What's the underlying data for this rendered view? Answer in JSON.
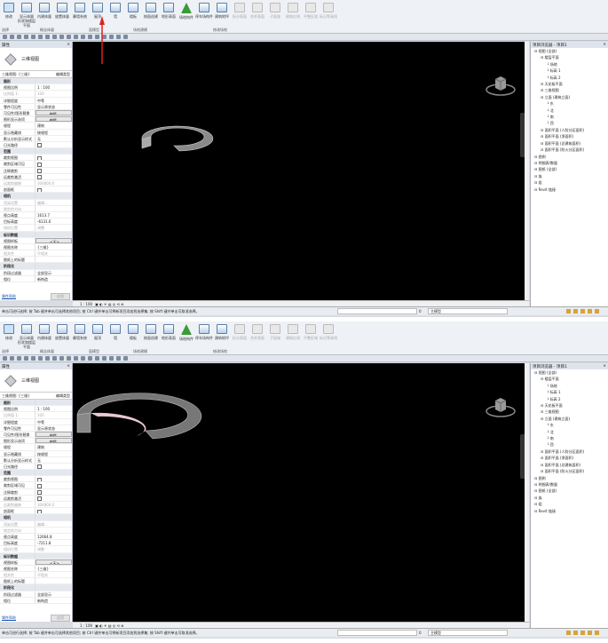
{
  "ribbon": {
    "buttons": [
      "修改",
      "显示体量 形状和楼层平面",
      "内建体量",
      "放置体量",
      "幕墙系统",
      "屋顶",
      "墙",
      "楼板",
      "按面创建",
      "地形表面",
      "场地构件",
      "停车场构件",
      "建筑地坪",
      "拆分表面",
      "合并表面",
      "子面域",
      "建筑红线",
      "平整区域",
      "标记等高线"
    ],
    "groups": [
      "选择",
      "概念体量",
      "面模型",
      "场地建模",
      "修改场地"
    ]
  },
  "properties": {
    "title": "属性",
    "type_name": "三维视图",
    "instance_select": "三维视图: {三维}",
    "edit_type": "编辑类型",
    "rows": [
      {
        "k": "图形",
        "v": "",
        "sec": true
      },
      {
        "k": "视图比例",
        "v": "1 : 100"
      },
      {
        "k": "比例值 1:",
        "v": "100",
        "dim": true
      },
      {
        "k": "详细程度",
        "v": "中等"
      },
      {
        "k": "零件可见性",
        "v": "显示原状态"
      },
      {
        "k": "可见性/图形替换",
        "v": "编辑...",
        "btn": true
      },
      {
        "k": "图形显示选项",
        "v": "编辑...",
        "btn": true
      },
      {
        "k": "规程",
        "v": "建筑"
      },
      {
        "k": "显示隐藏线",
        "v": "按规程"
      },
      {
        "k": "默认分析显示样式",
        "v": "无"
      },
      {
        "k": "日光路径",
        "v": "",
        "cb": true
      },
      {
        "k": "范围",
        "v": "",
        "sec": true
      },
      {
        "k": "裁剪视图",
        "v": "",
        "cb": true
      },
      {
        "k": "裁剪区域可见",
        "v": "",
        "cb": true
      },
      {
        "k": "注释裁剪",
        "v": "",
        "cb": true
      },
      {
        "k": "远裁剪激活",
        "v": "",
        "cb": true
      },
      {
        "k": "远裁剪偏移",
        "v": "304800.0",
        "dim": true
      },
      {
        "k": "剖面框",
        "v": "",
        "cb": true
      },
      {
        "k": "相机",
        "v": "",
        "sec": true
      },
      {
        "k": "渲染设置",
        "v": "编辑...",
        "dim": true
      },
      {
        "k": "锁定的方向",
        "v": "",
        "dim": true
      },
      {
        "k": "视点高度",
        "v": "@eye"
      },
      {
        "k": "目标高度",
        "v": "@target"
      },
      {
        "k": "相机位置",
        "v": "调整",
        "dim": true
      },
      {
        "k": "标识数据",
        "v": "",
        "sec": true
      },
      {
        "k": "视图样板",
        "v": "<无>",
        "btn": true
      },
      {
        "k": "视图名称",
        "v": "{三维}"
      },
      {
        "k": "相关性",
        "v": "不相关",
        "dim": true
      },
      {
        "k": "图纸上的标题",
        "v": ""
      },
      {
        "k": "阶段化",
        "v": "",
        "sec": true
      },
      {
        "k": "阶段过滤器",
        "v": "全部显示"
      },
      {
        "k": "相位",
        "v": "新构造"
      }
    ],
    "help_link": "属性帮助",
    "apply": "应用"
  },
  "browser": {
    "title": "项目浏览器 - 项目1",
    "items": [
      {
        "t": "视图 (全部)",
        "d": 0
      },
      {
        "t": "楼层平面",
        "d": 1
      },
      {
        "t": "场地",
        "d": 2
      },
      {
        "t": "标高 1",
        "d": 2
      },
      {
        "t": "标高 2",
        "d": 2
      },
      {
        "t": "天花板平面",
        "d": 1
      },
      {
        "t": "三维视图",
        "d": 1
      },
      {
        "t": "立面 (建筑立面)",
        "d": 1
      },
      {
        "t": "东",
        "d": 2
      },
      {
        "t": "北",
        "d": 2
      },
      {
        "t": "南",
        "d": 2
      },
      {
        "t": "西",
        "d": 2
      },
      {
        "t": "面积平面 (人防分区面积)",
        "d": 1
      },
      {
        "t": "面积平面 (净面积)",
        "d": 1
      },
      {
        "t": "面积平面 (总建筑面积)",
        "d": 1
      },
      {
        "t": "面积平面 (防火分区面积)",
        "d": 1
      },
      {
        "t": "图例",
        "d": 0
      },
      {
        "t": "明细表/数量",
        "d": 0
      },
      {
        "t": "图纸 (全部)",
        "d": 0
      },
      {
        "t": "族",
        "d": 0
      },
      {
        "t": "组",
        "d": 0
      },
      {
        "t": "Revit 链接",
        "d": 0
      }
    ]
  },
  "viewbar": {
    "scale": "1 : 100"
  },
  "status": {
    "hint": "单击可进行选择; 按 Tab 键并单击可选择其他项目; 按 Ctrl 键并单击可将新项目添加到选择集; 按 Shift 键并单击可取消选择。",
    "zero": "0",
    "model": "主模型"
  },
  "screens": [
    {
      "eye": "1613.7",
      "target": "-6131.6",
      "highlight": false
    },
    {
      "eye": "12664.8",
      "target": "-7211.8",
      "highlight": true
    }
  ],
  "colors": {
    "viewport": "#000000",
    "arrow": "#e02020",
    "wall_highlight": "#e8c8d8"
  }
}
